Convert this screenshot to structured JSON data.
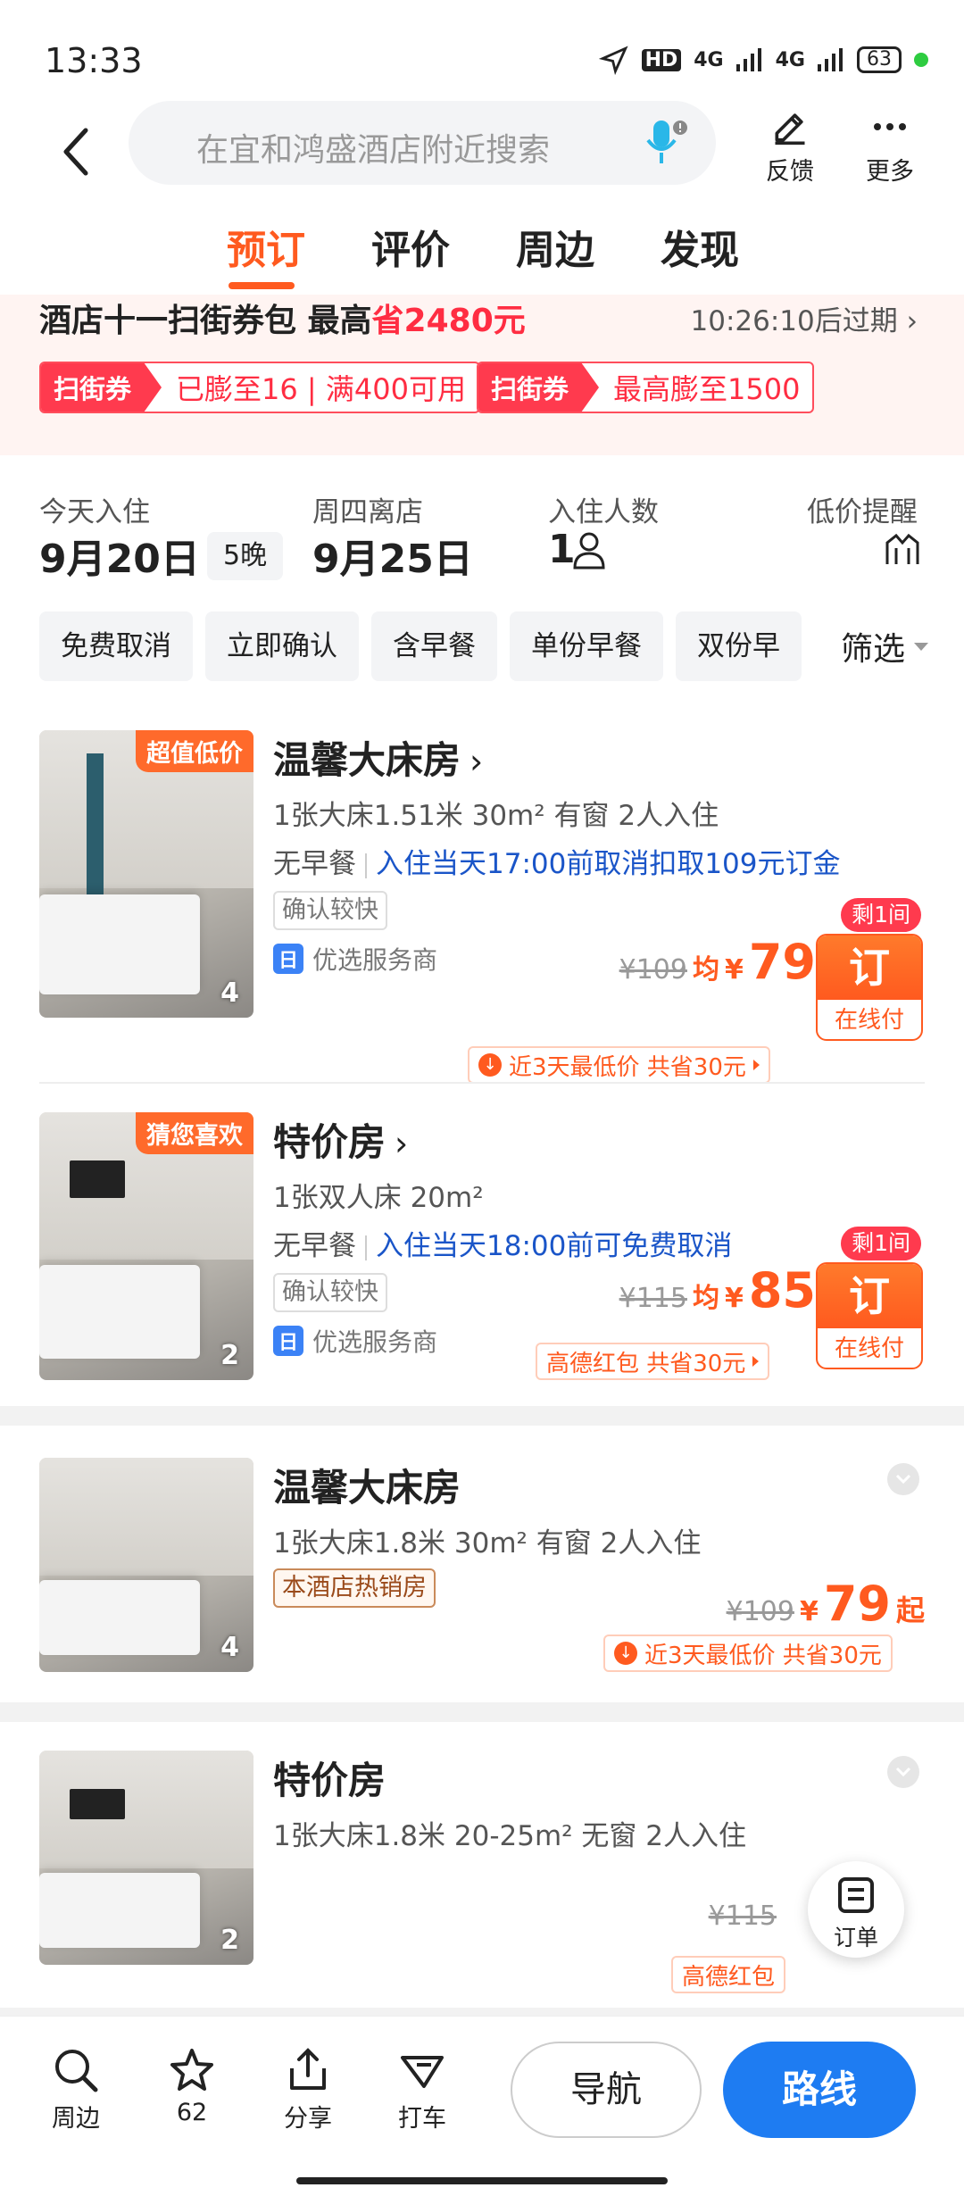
{
  "status_bar": {
    "time": "13:33",
    "hd": "HD",
    "net1": "4G",
    "net2": "4G",
    "battery": "63"
  },
  "header": {
    "search_placeholder": "在宜和鸿盛酒店附近搜索",
    "feedback_label": "反馈",
    "more_label": "更多"
  },
  "tabs": [
    {
      "label": "预订",
      "active": true
    },
    {
      "label": "评价",
      "active": false
    },
    {
      "label": "周边",
      "active": false
    },
    {
      "label": "发现",
      "active": false
    }
  ],
  "coupon": {
    "title_prefix": "酒店十一扫街券包  最高",
    "title_highlight": "省2480元",
    "expire": "10:26:10后过期",
    "tags": [
      {
        "badge": "扫街券",
        "text": "已膨至16 | 满400可用"
      },
      {
        "badge": "扫街券",
        "text": "最高膨至1500"
      }
    ]
  },
  "booking": {
    "checkin_label": "今天入住",
    "checkin_date": "9月20日",
    "nights": "5晚",
    "checkout_label": "周四离店",
    "checkout_date": "9月25日",
    "guests_label": "入住人数",
    "guests_count": "1",
    "price_alert_label": "低价提醒"
  },
  "filters": {
    "chips": [
      "免费取消",
      "立即确认",
      "含早餐",
      "单份早餐",
      "双份早"
    ],
    "filter_label": "筛选"
  },
  "rooms": [
    {
      "name": "温馨大床房",
      "ribbon": "超值低价",
      "photo_count": "4",
      "spec": "1张大床1.51米  30m²  有窗  2人入住",
      "breakfast": "无早餐",
      "policy": "入住当天17:00前取消扣取109元订金",
      "confirm_tag": "确认较快",
      "service": "优选服务商",
      "old_price": "¥109",
      "avg_label": "均",
      "yen": "¥",
      "price": "79",
      "rooms_left": "剩1间",
      "book_label": "订",
      "pay_label": "在线付",
      "deal": "近3天最低价  共省30元"
    },
    {
      "name": "特价房",
      "ribbon": "猜您喜欢",
      "photo_count": "2",
      "spec": "1张双人床  20m²",
      "breakfast": "无早餐",
      "policy": "入住当天18:00前可免费取消",
      "confirm_tag": "确认较快",
      "service": "优选服务商",
      "old_price": "¥115",
      "avg_label": "均",
      "yen": "¥",
      "price": "85",
      "rooms_left": "剩1间",
      "book_label": "订",
      "pay_label": "在线付",
      "deal": "高德红包  共省30元"
    },
    {
      "name": "温馨大床房",
      "photo_count": "4",
      "spec": "1张大床1.8米  30m²  有窗  2人入住",
      "hot_tag": "本酒店热销房",
      "old_price": "¥109",
      "yen": "¥",
      "price": "79",
      "suffix": "起",
      "deal": "近3天最低价  共省30元"
    },
    {
      "name": "特价房",
      "photo_count": "2",
      "spec": "1张大床1.8米  20-25m²  无窗  2人入住",
      "old_price": "¥115",
      "deal": "高德红包"
    }
  ],
  "fab": {
    "order_label": "订单"
  },
  "bottom_bar": {
    "nearby": "周边",
    "favorites": "62",
    "share": "分享",
    "taxi": "打车",
    "navigate": "导航",
    "route": "路线"
  },
  "colors": {
    "accent": "#ff5a1f",
    "coupon_red": "#ff2d42",
    "link_blue": "#1a55c8",
    "route_blue": "#1e7cf2"
  }
}
